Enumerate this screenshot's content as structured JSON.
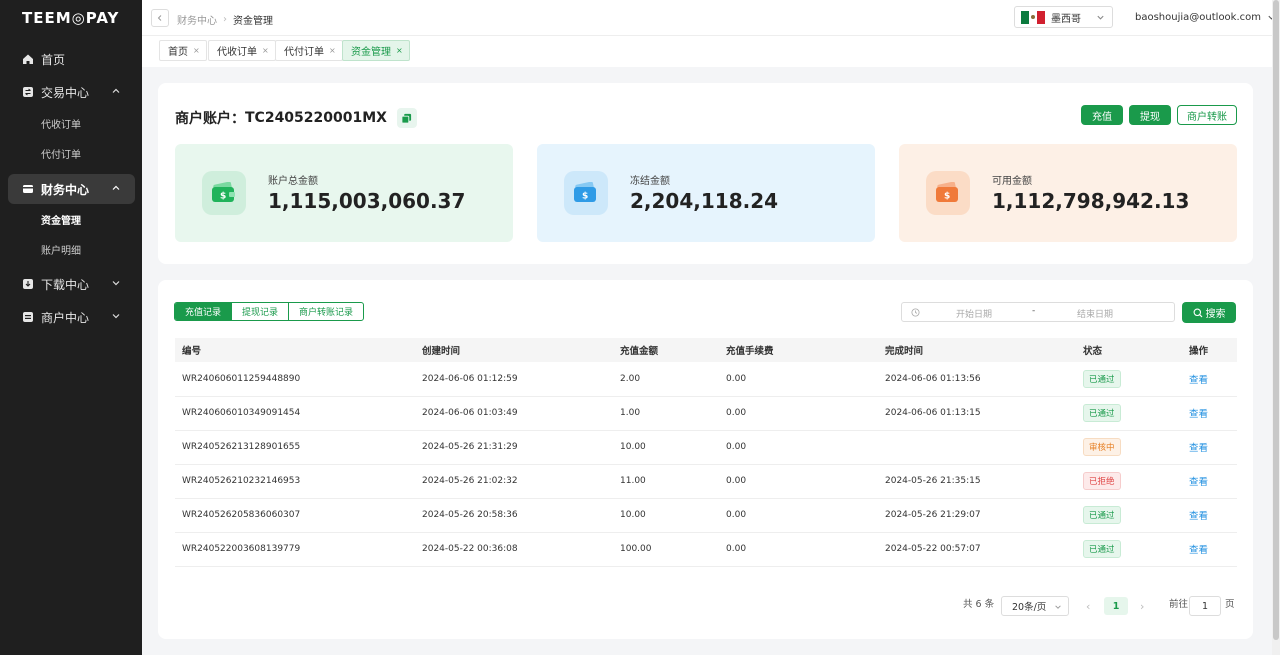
{
  "brand": {
    "logo_text": "TEEM◎PAY"
  },
  "sidebar": {
    "items": [
      {
        "label": "首页",
        "icon": "home-icon"
      },
      {
        "label": "交易中心",
        "icon": "exchange-icon"
      },
      {
        "label": "财务中心",
        "icon": "finance-icon"
      },
      {
        "label": "下载中心",
        "icon": "download-icon"
      },
      {
        "label": "商户中心",
        "icon": "merchant-icon"
      }
    ],
    "trade_sub": [
      "代收订单",
      "代付订单"
    ],
    "finance_sub": [
      "资金管理",
      "账户明细"
    ]
  },
  "header": {
    "breadcrumb_parent": "财务中心",
    "breadcrumb_current": "资金管理",
    "country": "墨西哥",
    "user_email": "baoshoujia@outlook.com"
  },
  "tabs": [
    {
      "label": "首页"
    },
    {
      "label": "代收订单"
    },
    {
      "label": "代付订单"
    },
    {
      "label": "资金管理"
    }
  ],
  "account": {
    "title_prefix": "商户账户：",
    "account_id": "TC2405220001MX",
    "actions": {
      "recharge": "充值",
      "withdraw": "提现",
      "transfer": "商户转账"
    },
    "stats": [
      {
        "label": "账户总金额",
        "value": "1,115,003,060.37",
        "color": "#20b35b"
      },
      {
        "label": "冻结金额",
        "value": "2,204,118.24",
        "color": "#2f9be6"
      },
      {
        "label": "可用金额",
        "value": "1,112,798,942.13",
        "color": "#f07a3a"
      }
    ]
  },
  "records": {
    "segments": [
      "充值记录",
      "提现记录",
      "商户转账记录"
    ],
    "date_start_placeholder": "开始日期",
    "date_sep": "-",
    "date_end_placeholder": "结束日期",
    "search_label": "搜索",
    "columns": [
      "编号",
      "创建时间",
      "充值金额",
      "充值手续费",
      "完成时间",
      "状态",
      "操作"
    ],
    "rows": [
      {
        "id": "WR240606011259448890",
        "created": "2024-06-06 01:12:59",
        "amount": "2.00",
        "fee": "0.00",
        "completed": "2024-06-06 01:13:56",
        "status": "已通过",
        "status_type": "ok",
        "action": "查看"
      },
      {
        "id": "WR240606010349091454",
        "created": "2024-06-06 01:03:49",
        "amount": "1.00",
        "fee": "0.00",
        "completed": "2024-06-06 01:13:15",
        "status": "已通过",
        "status_type": "ok",
        "action": "查看"
      },
      {
        "id": "WR240526213128901655",
        "created": "2024-05-26 21:31:29",
        "amount": "10.00",
        "fee": "0.00",
        "completed": "",
        "status": "审核中",
        "status_type": "wait",
        "action": "查看"
      },
      {
        "id": "WR240526210232146953",
        "created": "2024-05-26 21:02:32",
        "amount": "11.00",
        "fee": "0.00",
        "completed": "2024-05-26 21:35:15",
        "status": "已拒绝",
        "status_type": "no",
        "action": "查看"
      },
      {
        "id": "WR240526205836060307",
        "created": "2024-05-26 20:58:36",
        "amount": "10.00",
        "fee": "0.00",
        "completed": "2024-05-26 21:29:07",
        "status": "已通过",
        "status_type": "ok",
        "action": "查看"
      },
      {
        "id": "WR240522003608139779",
        "created": "2024-05-22 00:36:08",
        "amount": "100.00",
        "fee": "0.00",
        "completed": "2024-05-22 00:57:07",
        "status": "已通过",
        "status_type": "ok",
        "action": "查看"
      }
    ]
  },
  "pagination": {
    "total_text": "共 6 条",
    "page_size": "20条/页",
    "current_page": "1",
    "goto_label": "前往",
    "goto_value": "1",
    "page_suffix": "页"
  }
}
